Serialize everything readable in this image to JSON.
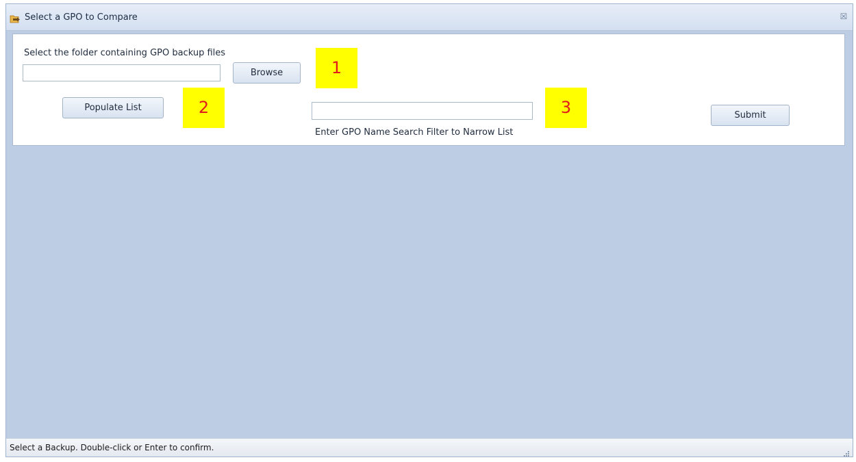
{
  "window": {
    "title": "Select a GPO to Compare",
    "close_glyph": "☒"
  },
  "form": {
    "folder_label": "Select the folder containing GPO backup files",
    "folder_value": "",
    "browse_label": "Browse",
    "populate_label": "Populate List",
    "filter_value": "",
    "filter_hint": "Enter GPO Name Search Filter to Narrow List",
    "submit_label": "Submit"
  },
  "markers": [
    "1",
    "2",
    "3"
  ],
  "status": {
    "text": "Select a Backup. Double-click or Enter to confirm."
  },
  "icons": {
    "title": "folder-arrow-icon",
    "close": "close-icon",
    "grip": "resize-grip-icon"
  },
  "colors": {
    "marker_bg": "#ffff00",
    "marker_text": "#e21b1b",
    "client_area": "#bdcee4"
  }
}
